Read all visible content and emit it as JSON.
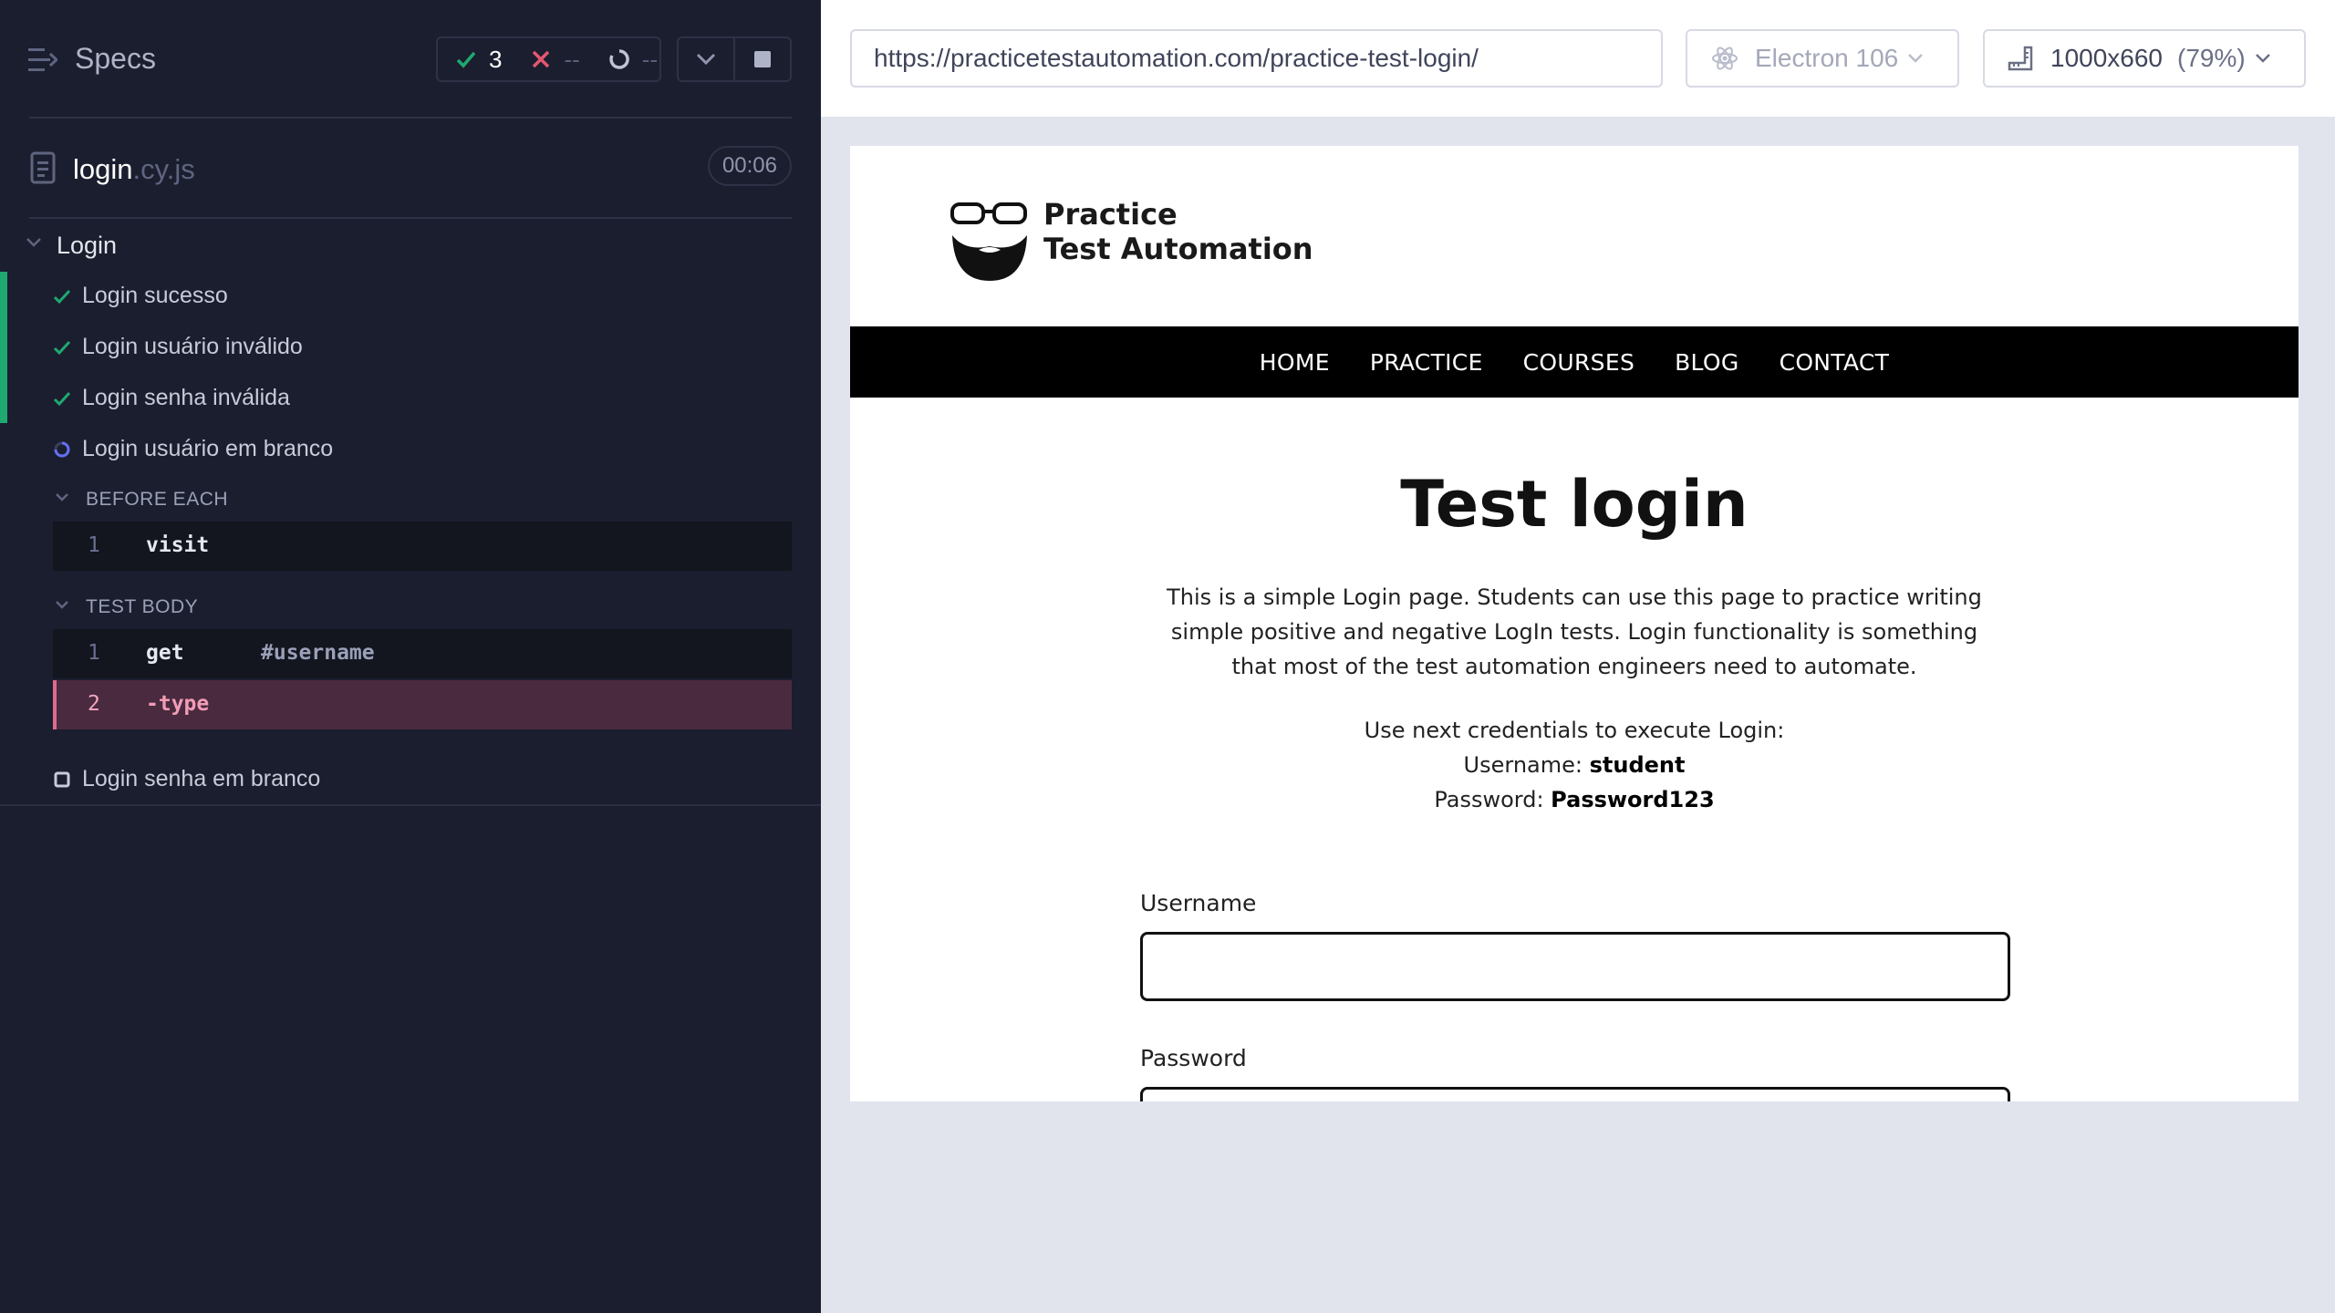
{
  "reporter": {
    "title": "Specs",
    "stats": {
      "passed": "3",
      "failed": "--",
      "pending": "--"
    },
    "file": {
      "base": "login",
      "ext": ".cy.js",
      "duration": "00:06"
    },
    "suite": "Login",
    "tests": [
      {
        "label": "Login sucesso",
        "state": "passed"
      },
      {
        "label": "Login usuário inválido",
        "state": "passed"
      },
      {
        "label": "Login senha inválida",
        "state": "passed"
      },
      {
        "label": "Login usuário em branco",
        "state": "running"
      },
      {
        "label": "Login senha em branco",
        "state": "pending"
      }
    ],
    "before_each": {
      "title": "BEFORE EACH",
      "commands": [
        {
          "num": "1",
          "name": "visit",
          "arg": ""
        }
      ]
    },
    "test_body": {
      "title": "TEST BODY",
      "commands": [
        {
          "num": "1",
          "name": "get",
          "arg": "#username"
        },
        {
          "num": "2",
          "name": "-type",
          "arg": ""
        }
      ]
    }
  },
  "aut": {
    "url": "https://practicetestautomation.com/practice-test-login/",
    "browser": "Electron 106",
    "viewport": "1000x660",
    "scale": "(79%)"
  },
  "site": {
    "brand_line1": "Practice",
    "brand_line2": "Test Automation",
    "nav": [
      "HOME",
      "PRACTICE",
      "COURSES",
      "BLOG",
      "CONTACT"
    ],
    "title": "Test login",
    "intro": "This is a simple Login page. Students can use this page to practice writing simple positive and negative LogIn tests. Login functionality is something that most of the test automation engineers need to automate.",
    "creds_intro": "Use next credentials to execute Login:",
    "username_label": "Username:",
    "username_value": "student",
    "password_label": "Password:",
    "password_value": "Password123",
    "field_username": "Username",
    "field_password": "Password"
  },
  "colors": {
    "pass": "#1fa971",
    "fail": "#e45770",
    "running": "#6470f3",
    "panel": "#1b1e2e"
  }
}
